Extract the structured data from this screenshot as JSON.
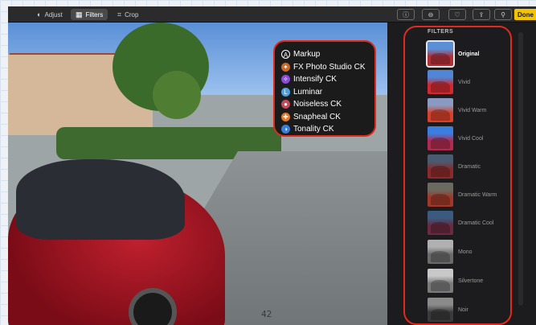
{
  "toolbar": {
    "adjust_label": "Adjust",
    "filters_label": "Filters",
    "crop_label": "Crop",
    "done_label": "Done"
  },
  "extensions_menu": {
    "items": [
      {
        "label": "Markup",
        "icon": "markup-icon",
        "color": "#ffffff"
      },
      {
        "label": "FX Photo Studio CK",
        "icon": "fx-photo-studio-icon",
        "color": "#c76a2a"
      },
      {
        "label": "Intensify CK",
        "icon": "intensify-icon",
        "color": "#8a4dd6"
      },
      {
        "label": "Luminar",
        "icon": "luminar-icon",
        "color": "#4aa0e0"
      },
      {
        "label": "Noiseless CK",
        "icon": "noiseless-icon",
        "color": "#c84a5a"
      },
      {
        "label": "Snapheal CK",
        "icon": "snapheal-icon",
        "color": "#e07a2a"
      },
      {
        "label": "Tonality CK",
        "icon": "tonality-icon",
        "color": "#3a7ed6"
      }
    ]
  },
  "filters_panel": {
    "title": "FILTERS",
    "items": [
      {
        "label": "Original",
        "selected": true,
        "tint": "#b03038"
      },
      {
        "label": "Vivid",
        "selected": false,
        "tint": "#d02a30"
      },
      {
        "label": "Vivid Warm",
        "selected": false,
        "tint": "#d8402a"
      },
      {
        "label": "Vivid Cool",
        "selected": false,
        "tint": "#b02a50"
      },
      {
        "label": "Dramatic",
        "selected": false,
        "tint": "#8a2a2a"
      },
      {
        "label": "Dramatic Warm",
        "selected": false,
        "tint": "#a0382a"
      },
      {
        "label": "Dramatic Cool",
        "selected": false,
        "tint": "#6a2a40"
      },
      {
        "label": "Mono",
        "selected": false,
        "tint": "#8a8a8a"
      },
      {
        "label": "Silvertone",
        "selected": false,
        "tint": "#a0a0a0"
      },
      {
        "label": "Noir",
        "selected": false,
        "tint": "#5a5a5a"
      }
    ]
  },
  "page_number": "42",
  "colors": {
    "accent_highlight": "#e02a1b",
    "done_button": "#f5c400"
  }
}
